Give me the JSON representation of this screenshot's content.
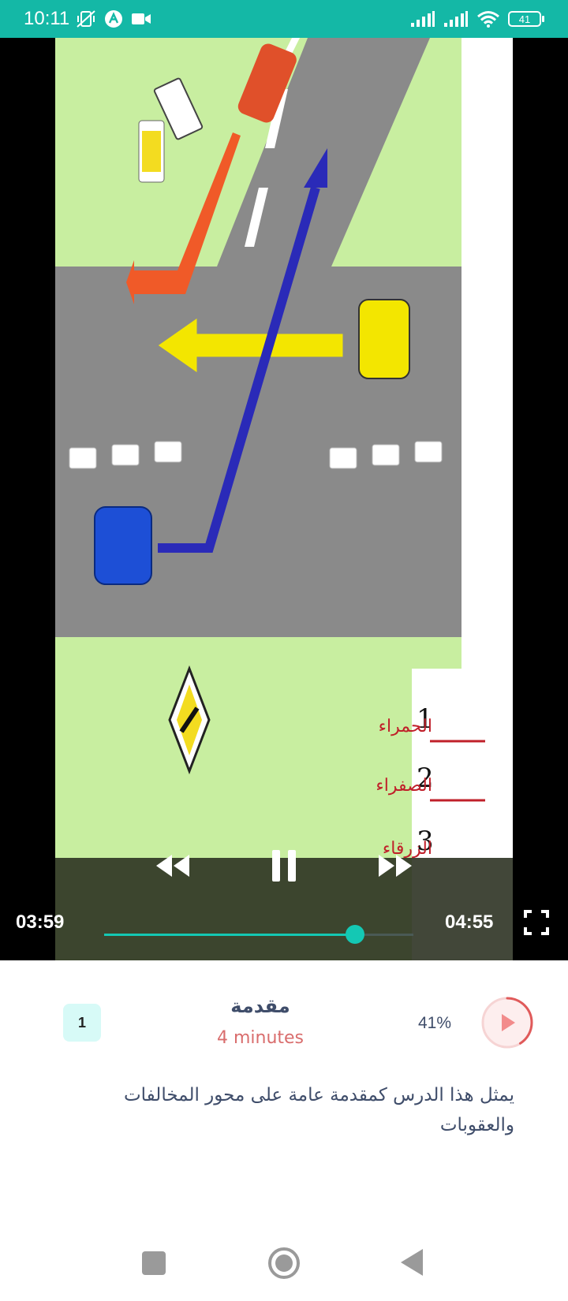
{
  "status_bar": {
    "time": "10:11",
    "battery_level": "41"
  },
  "video": {
    "current_time": "03:59",
    "duration": "04:55",
    "progress_fraction": 0.81,
    "slide_labels": [
      "1",
      "الحمراء",
      "2",
      "الصفراء",
      "3",
      "الزرقاء"
    ]
  },
  "lesson": {
    "number": "1",
    "title": "مقدمة",
    "duration": "4 minutes",
    "progress_percent": "41%",
    "description": "يمثل هذا الدرس كمقدمة عامة على محور المخالفات والعقوبات"
  },
  "colors": {
    "accent": "#14b8a6",
    "title_text": "#3f4d6a",
    "duration_text": "#d96d6d",
    "play_ring": "#e05a5a"
  },
  "icons": {
    "rewind": "rewind-icon",
    "pause": "pause-icon",
    "forward": "fast-forward-icon",
    "fullscreen": "fullscreen-icon",
    "play": "play-icon"
  }
}
